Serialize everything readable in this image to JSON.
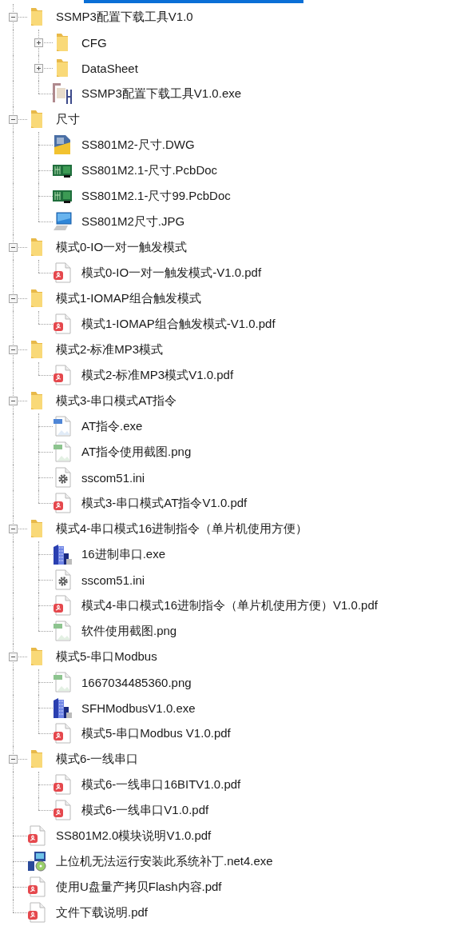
{
  "tree": [
    {
      "name": "SSMP3配置下载工具V1.0",
      "kind": "folder",
      "expanded": true,
      "children": [
        {
          "name": "CFG",
          "kind": "folder",
          "expanded": false
        },
        {
          "name": "DataSheet",
          "kind": "folder",
          "expanded": false
        },
        {
          "name": "SSMP3配置下载工具V1.0.exe",
          "kind": "logo-app"
        }
      ]
    },
    {
      "name": "尺寸",
      "kind": "folder",
      "expanded": true,
      "children": [
        {
          "name": "SS801M2-尺寸.DWG",
          "kind": "dwg"
        },
        {
          "name": "SS801M2.1-尺寸.PcbDoc",
          "kind": "pcb"
        },
        {
          "name": "SS801M2.1-尺寸99.PcbDoc",
          "kind": "pcb"
        },
        {
          "name": "SS801M2尺寸.JPG",
          "kind": "monitor"
        }
      ]
    },
    {
      "name": "模式0-IO一对一触发模式",
      "kind": "folder",
      "expanded": true,
      "children": [
        {
          "name": "模式0-IO一对一触发模式-V1.0.pdf",
          "kind": "pdf"
        }
      ]
    },
    {
      "name": "模式1-IOMAP组合触发模式",
      "kind": "folder",
      "expanded": true,
      "children": [
        {
          "name": "模式1-IOMAP组合触发模式-V1.0.pdf",
          "kind": "pdf"
        }
      ]
    },
    {
      "name": "模式2-标准MP3模式",
      "kind": "folder",
      "expanded": true,
      "children": [
        {
          "name": "模式2-标准MP3模式V1.0.pdf",
          "kind": "pdf"
        }
      ]
    },
    {
      "name": "模式3-串口模式AT指令",
      "kind": "folder",
      "expanded": true,
      "children": [
        {
          "name": "AT指令.exe",
          "kind": "jpg"
        },
        {
          "name": "AT指令使用截图.png",
          "kind": "png"
        },
        {
          "name": "sscom51.ini",
          "kind": "ini"
        },
        {
          "name": "模式3-串口模式AT指令V1.0.pdf",
          "kind": "pdf"
        }
      ]
    },
    {
      "name": "模式4-串口模式16进制指令（单片机使用方便）",
      "kind": "folder",
      "expanded": true,
      "children": [
        {
          "name": "16进制串口.exe",
          "kind": "building"
        },
        {
          "name": "sscom51.ini",
          "kind": "ini"
        },
        {
          "name": "模式4-串口模式16进制指令（单片机使用方便）V1.0.pdf",
          "kind": "pdf"
        },
        {
          "name": "软件使用截图.png",
          "kind": "png"
        }
      ]
    },
    {
      "name": "模式5-串口Modbus",
      "kind": "folder",
      "expanded": true,
      "children": [
        {
          "name": "1667034485360.png",
          "kind": "png"
        },
        {
          "name": "SFHModbusV1.0.exe",
          "kind": "building"
        },
        {
          "name": "模式5-串口Modbus V1.0.pdf",
          "kind": "pdf"
        }
      ]
    },
    {
      "name": "模式6-一线串口",
      "kind": "folder",
      "expanded": true,
      "children": [
        {
          "name": "模式6-一线串口16BITV1.0.pdf",
          "kind": "pdf"
        },
        {
          "name": "模式6-一线串口V1.0.pdf",
          "kind": "pdf"
        }
      ]
    },
    {
      "name": "SS801M2.0模块说明V1.0.pdf",
      "kind": "pdf"
    },
    {
      "name": "上位机无法运行安装此系统补丁.net4.exe",
      "kind": "installer"
    },
    {
      "name": "使用U盘量产拷贝Flash内容.pdf",
      "kind": "pdf"
    },
    {
      "name": "文件下载说明.pdf",
      "kind": "pdf"
    }
  ]
}
